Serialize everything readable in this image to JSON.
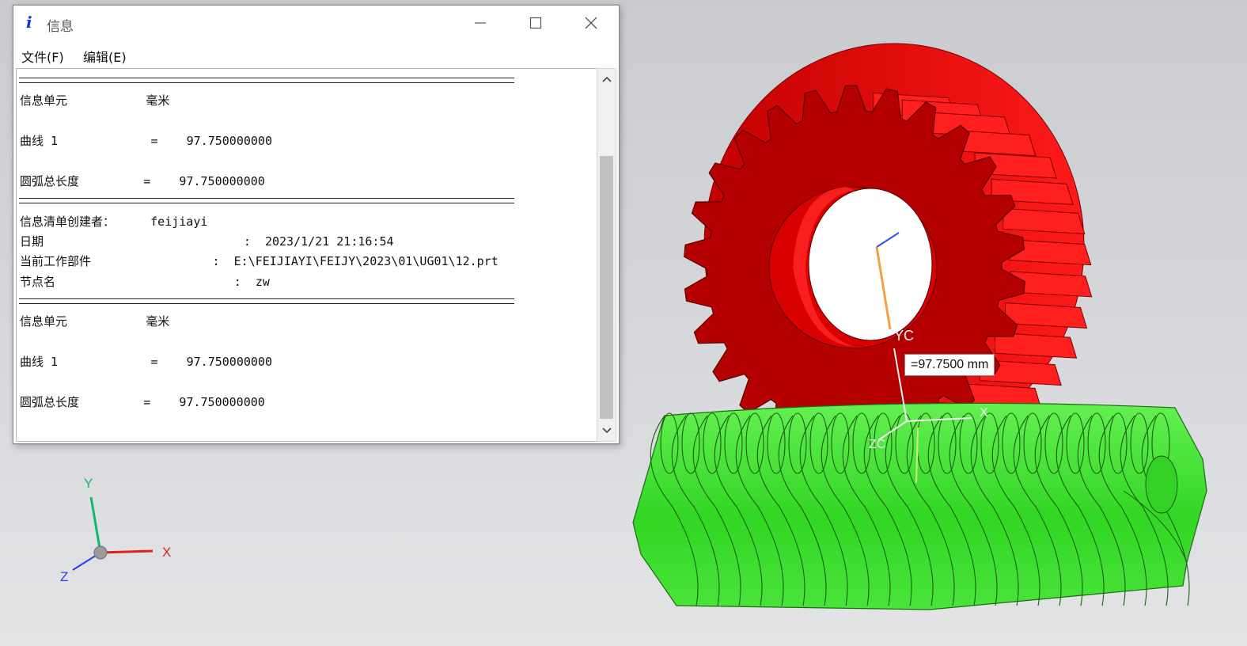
{
  "window": {
    "title": "信息",
    "icon": "info-icon",
    "controls": {
      "minimize": "minimize-icon",
      "maximize": "maximize-icon",
      "close": "close-icon"
    }
  },
  "menu": {
    "file": "文件(F)",
    "edit": "编辑(E)"
  },
  "info": {
    "separator": "================================================================",
    "lines": [
      "信息单元           毫米",
      "曲线 1             =    97.750000000",
      "圆弧总长度         =    97.750000000",
      "信息清单创建者：     feijiayi",
      "日期                            :  2023/1/21 21:16:54",
      "当前工作部件                 :  E:\\FEIJIAYI\\FEIJY\\2023\\01\\UG01\\12.prt",
      "节点名                         :  zw",
      "信息单元           毫米",
      "曲线 1             =    97.750000000",
      "圆弧总长度         =    97.750000000"
    ]
  },
  "viewport": {
    "dimension_label": "=97.7500 mm",
    "wcs_y_label": "YC",
    "wcs_x_label": "X",
    "wcs_z_label": "ZC",
    "triad": {
      "x": "X",
      "y": "Y",
      "z": "Z"
    },
    "colors": {
      "gear": "#e10000",
      "worm": "#39e629",
      "x_axis": "#e02020",
      "y_axis": "#10b870",
      "z_axis": "#2a3ee8"
    }
  }
}
